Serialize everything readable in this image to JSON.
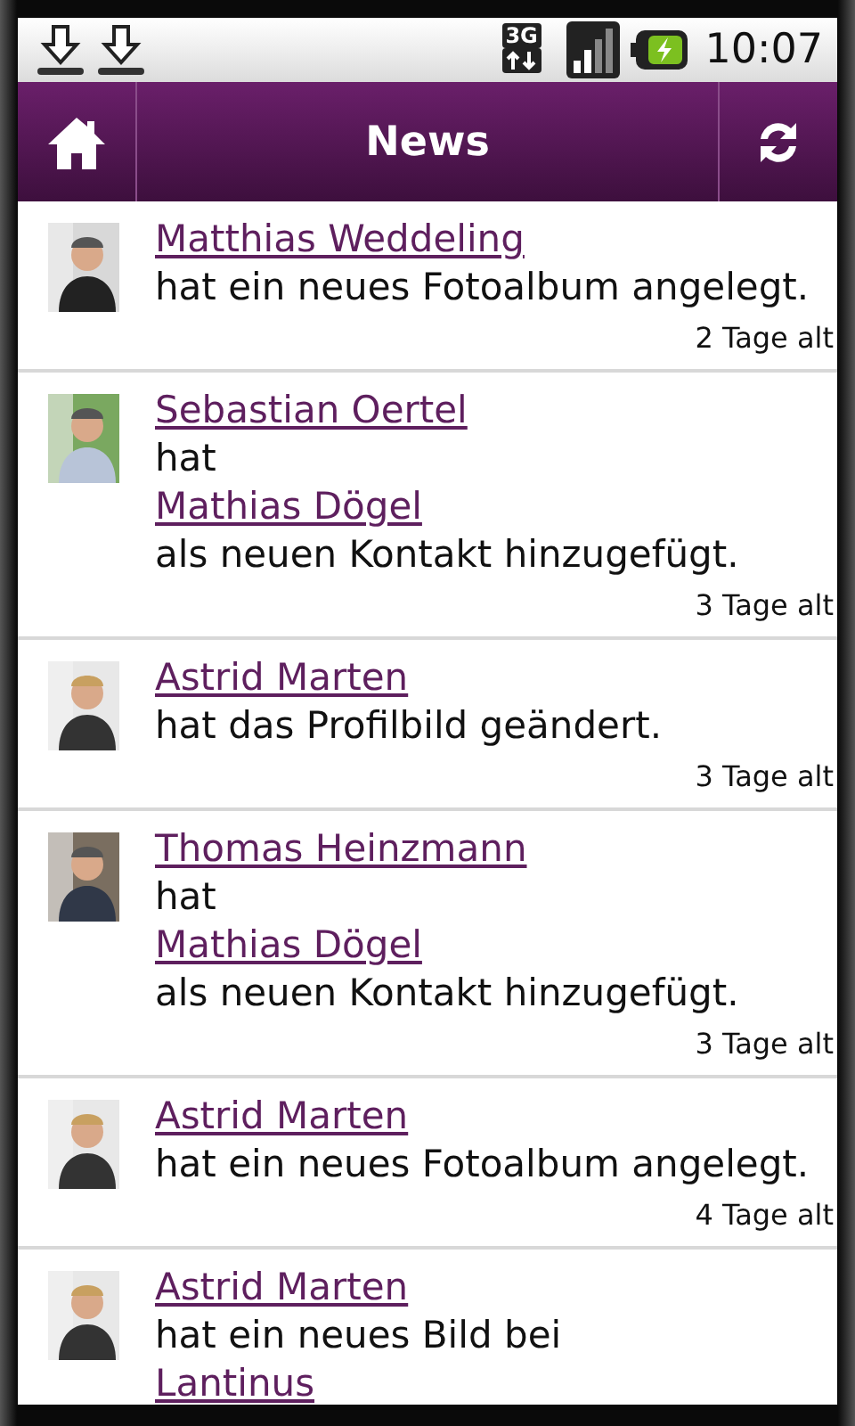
{
  "status_bar": {
    "network_type": "3G",
    "time": "10:07"
  },
  "header": {
    "title": "News"
  },
  "news": [
    {
      "lines": [
        {
          "kind": "link",
          "text": "Matthias Weddeling"
        },
        {
          "kind": "text",
          "text": "hat ein neues Fotoalbum angelegt."
        }
      ],
      "time": "2 Tage alt"
    },
    {
      "lines": [
        {
          "kind": "link",
          "text": "Sebastian Oertel"
        },
        {
          "kind": "text",
          "text": "hat"
        },
        {
          "kind": "link",
          "text": "Mathias Dögel"
        },
        {
          "kind": "text",
          "text": "als neuen Kontakt hinzugefügt."
        }
      ],
      "time": "3 Tage alt"
    },
    {
      "lines": [
        {
          "kind": "link",
          "text": "Astrid Marten"
        },
        {
          "kind": "text",
          "text": "hat das Profilbild geändert."
        }
      ],
      "time": "3 Tage alt"
    },
    {
      "lines": [
        {
          "kind": "link",
          "text": "Thomas Heinzmann"
        },
        {
          "kind": "text",
          "text": "hat"
        },
        {
          "kind": "link",
          "text": "Mathias Dögel"
        },
        {
          "kind": "text",
          "text": "als neuen Kontakt hinzugefügt."
        }
      ],
      "time": "3 Tage alt"
    },
    {
      "lines": [
        {
          "kind": "link",
          "text": "Astrid Marten"
        },
        {
          "kind": "text",
          "text": "hat ein neues Fotoalbum angelegt."
        }
      ],
      "time": "4 Tage alt"
    },
    {
      "lines": [
        {
          "kind": "link",
          "text": "Astrid Marten"
        },
        {
          "kind": "text",
          "text": "hat ein neues Bild bei"
        },
        {
          "kind": "link",
          "text": "Lantinus"
        }
      ]
    }
  ]
}
